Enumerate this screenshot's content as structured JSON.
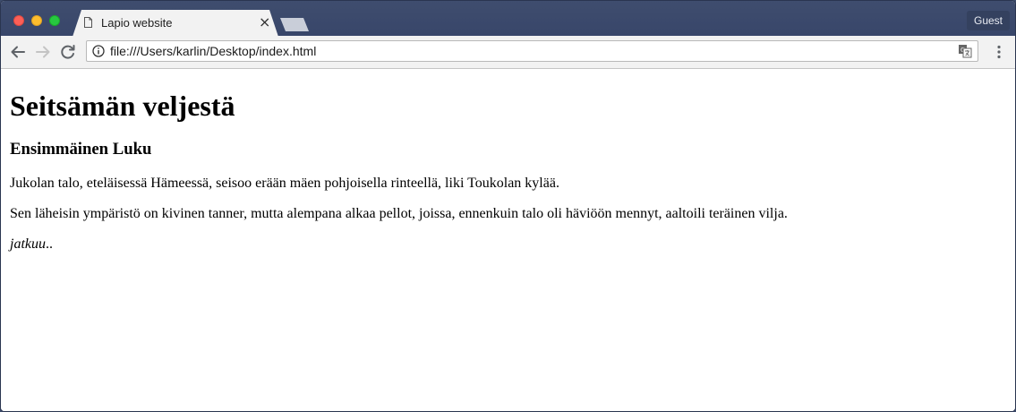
{
  "browser": {
    "tab_title": "Lapio website",
    "tab_close": "×",
    "profile_label": "Guest",
    "url": "file:///Users/karlin/Desktop/index.html",
    "icons": {
      "back": "arrow-left-icon",
      "forward": "arrow-right-icon",
      "reload": "reload-icon",
      "info": "info-icon",
      "translate": "translate-icon",
      "menu": "kebab-menu-icon",
      "page": "document-icon"
    }
  },
  "page": {
    "heading": "Seitsämän veljestä",
    "subheading": "Ensimmäinen Luku",
    "paragraph1": "Jukolan talo, eteläisessä Hämeessä, seisoo erään mäen pohjoisella rinteellä, liki Toukolan kylää.",
    "paragraph2": "Sen läheisin ympäristö on kivinen tanner, mutta alempana alkaa pellot, joissa, ennenkuin talo oli häviöön mennyt, aaltoili teräinen vilja.",
    "continue_em": "jatkuu",
    "continue_rest": ".."
  },
  "colors": {
    "titlebar": "#3d4b6b",
    "toolbar": "#f2f2f2",
    "close": "#fc5f57",
    "minimize": "#fdbd2e",
    "maximize": "#27c840"
  }
}
